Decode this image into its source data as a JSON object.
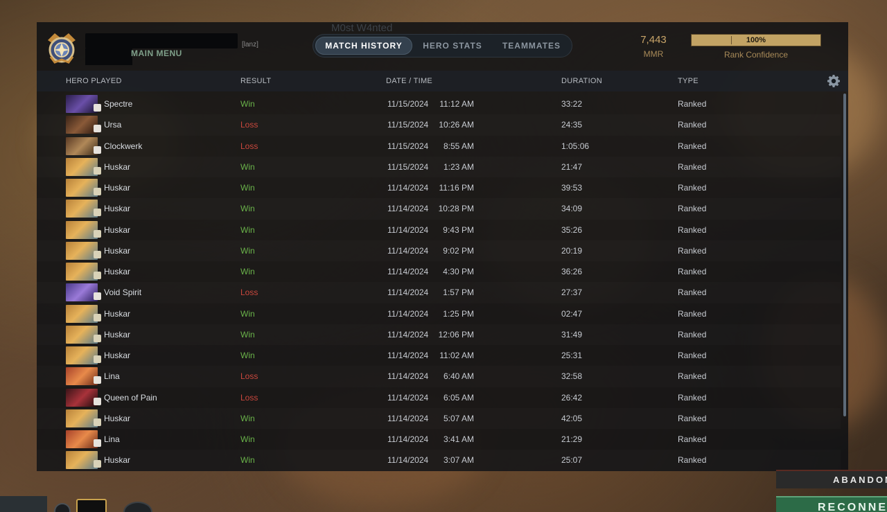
{
  "header": {
    "main_menu": "MAIN MENU",
    "tag_suffix": "[lanz]",
    "watermark": "M0st W4nted",
    "tabs": [
      {
        "label": "MATCH HISTORY",
        "active": true
      },
      {
        "label": "HERO STATS",
        "active": false
      },
      {
        "label": "TEAMMATES",
        "active": false
      }
    ],
    "mmr_value": "7,443",
    "mmr_label": "MMR",
    "rank_confidence_percent": "100%",
    "rank_confidence_fraction": 1.0,
    "rank_confidence_label": "Rank Confidence"
  },
  "columns": {
    "hero": "HERO PLAYED",
    "result": "RESULT",
    "datetime": "DATE / TIME",
    "duration": "DURATION",
    "type": "TYPE"
  },
  "colors": {
    "win": "#6ab34a",
    "loss": "#c9473d",
    "accent_gold": "#c9a569",
    "active_tab": "#34414e"
  },
  "matches": [
    {
      "hero": "Spectre",
      "result": "Win",
      "date": "11/15/2024",
      "time": "11:12 AM",
      "duration": "33:22",
      "type": "Ranked",
      "portrait": "spectre-portrait"
    },
    {
      "hero": "Ursa",
      "result": "Loss",
      "date": "11/15/2024",
      "time": "10:26 AM",
      "duration": "24:35",
      "type": "Ranked",
      "portrait": "ursa-portrait"
    },
    {
      "hero": "Clockwerk",
      "result": "Loss",
      "date": "11/15/2024",
      "time": "8:55 AM",
      "duration": "1:05:06",
      "type": "Ranked",
      "portrait": "clockwerk-portrait"
    },
    {
      "hero": "Huskar",
      "result": "Win",
      "date": "11/15/2024",
      "time": "1:23 AM",
      "duration": "21:47",
      "type": "Ranked",
      "portrait": "huskar-portrait"
    },
    {
      "hero": "Huskar",
      "result": "Win",
      "date": "11/14/2024",
      "time": "11:16 PM",
      "duration": "39:53",
      "type": "Ranked",
      "portrait": "huskar-portrait"
    },
    {
      "hero": "Huskar",
      "result": "Win",
      "date": "11/14/2024",
      "time": "10:28 PM",
      "duration": "34:09",
      "type": "Ranked",
      "portrait": "huskar-portrait"
    },
    {
      "hero": "Huskar",
      "result": "Win",
      "date": "11/14/2024",
      "time": "9:43 PM",
      "duration": "35:26",
      "type": "Ranked",
      "portrait": "huskar-portrait"
    },
    {
      "hero": "Huskar",
      "result": "Win",
      "date": "11/14/2024",
      "time": "9:02 PM",
      "duration": "20:19",
      "type": "Ranked",
      "portrait": "huskar-portrait"
    },
    {
      "hero": "Huskar",
      "result": "Win",
      "date": "11/14/2024",
      "time": "4:30 PM",
      "duration": "36:26",
      "type": "Ranked",
      "portrait": "huskar-portrait"
    },
    {
      "hero": "Void Spirit",
      "result": "Loss",
      "date": "11/14/2024",
      "time": "1:57 PM",
      "duration": "27:37",
      "type": "Ranked",
      "portrait": "void-spirit-portrait"
    },
    {
      "hero": "Huskar",
      "result": "Win",
      "date": "11/14/2024",
      "time": "1:25 PM",
      "duration": "02:47",
      "type": "Ranked",
      "portrait": "huskar-portrait"
    },
    {
      "hero": "Huskar",
      "result": "Win",
      "date": "11/14/2024",
      "time": "12:06 PM",
      "duration": "31:49",
      "type": "Ranked",
      "portrait": "huskar-portrait"
    },
    {
      "hero": "Huskar",
      "result": "Win",
      "date": "11/14/2024",
      "time": "11:02 AM",
      "duration": "25:31",
      "type": "Ranked",
      "portrait": "huskar-portrait"
    },
    {
      "hero": "Lina",
      "result": "Loss",
      "date": "11/14/2024",
      "time": "6:40 AM",
      "duration": "32:58",
      "type": "Ranked",
      "portrait": "lina-portrait"
    },
    {
      "hero": "Queen of Pain",
      "result": "Loss",
      "date": "11/14/2024",
      "time": "6:05 AM",
      "duration": "26:42",
      "type": "Ranked",
      "portrait": "queen-of-pain-portrait"
    },
    {
      "hero": "Huskar",
      "result": "Win",
      "date": "11/14/2024",
      "time": "5:07 AM",
      "duration": "42:05",
      "type": "Ranked",
      "portrait": "huskar-portrait"
    },
    {
      "hero": "Lina",
      "result": "Win",
      "date": "11/14/2024",
      "time": "3:41 AM",
      "duration": "21:29",
      "type": "Ranked",
      "portrait": "lina-portrait"
    },
    {
      "hero": "Huskar",
      "result": "Win",
      "date": "11/14/2024",
      "time": "3:07 AM",
      "duration": "25:07",
      "type": "Ranked",
      "portrait": "huskar-portrait"
    }
  ],
  "footer": {
    "abandon_label": "ABANDON",
    "reconnect_label": "RECONNECT"
  }
}
